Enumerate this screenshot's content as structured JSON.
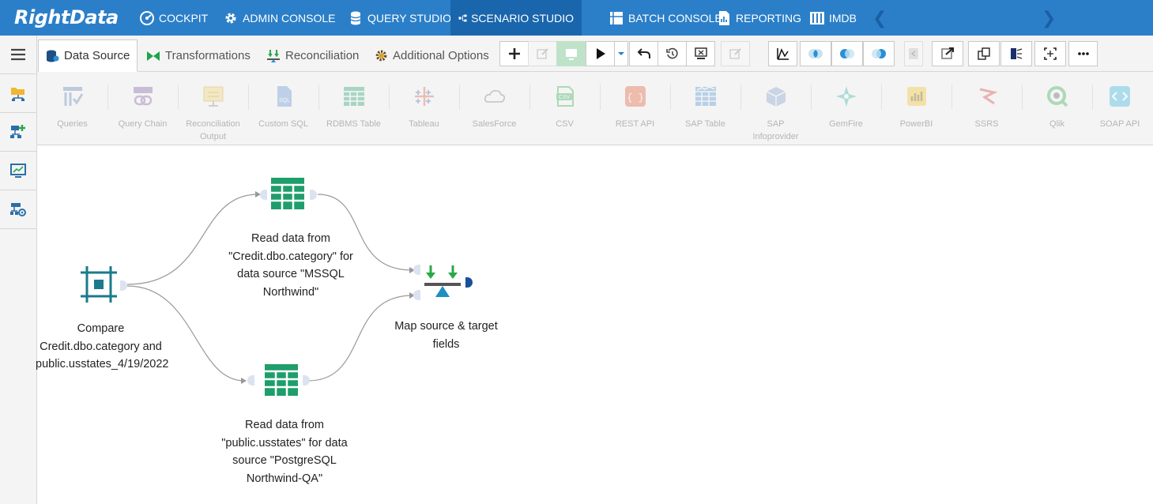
{
  "app": {
    "logo": "RightData",
    "nav": [
      {
        "label": "COCKPIT",
        "icon": "cockpit-icon"
      },
      {
        "label": "ADMIN CONSOLE",
        "icon": "gear-icon"
      },
      {
        "label": "QUERY STUDIO",
        "icon": "database-icon"
      },
      {
        "label": "SCENARIO STUDIO",
        "icon": "workflow-icon",
        "active": true
      },
      {
        "label": "BATCH CONSOLE",
        "icon": "batch-icon"
      },
      {
        "label": "REPORTING",
        "icon": "report-icon"
      },
      {
        "label": "IMDB",
        "icon": "imdb-icon"
      }
    ]
  },
  "toolbar": {
    "tabs": [
      {
        "label": "Data Source",
        "icon": "database-icon",
        "active": true
      },
      {
        "label": "Transformations",
        "icon": "bowtie-icon"
      },
      {
        "label": "Reconciliation",
        "icon": "reconcile-icon"
      },
      {
        "label": "Additional Options",
        "icon": "gear-icon"
      }
    ]
  },
  "ribbon": {
    "items": [
      "Queries",
      "Query Chain",
      "Reconciliation Output",
      "Custom SQL",
      "RDBMS Table",
      "Tableau",
      "SalesForce",
      "CSV",
      "REST API",
      "SAP Table",
      "SAP Infoprovider",
      "GemFire",
      "PowerBI",
      "SSRS",
      "Qlik",
      "SOAP API"
    ]
  },
  "canvas": {
    "nodes": {
      "compare": "Compare Credit.dbo.category and public.usstates_4/19/2022",
      "read_mssql": "Read data from \"Credit.dbo.category\" for data source \"MSSQL Northwind\"",
      "read_pg": "Read data from \"public.usstates\" for data source \"PostgreSQL Northwind-QA\"",
      "map": "Map source & target fields"
    }
  },
  "colors": {
    "nav_bg": "#2b7fc8",
    "nav_active": "#1a66ad",
    "teal": "#1b7a8c",
    "green_table": "#1e9e6a"
  }
}
